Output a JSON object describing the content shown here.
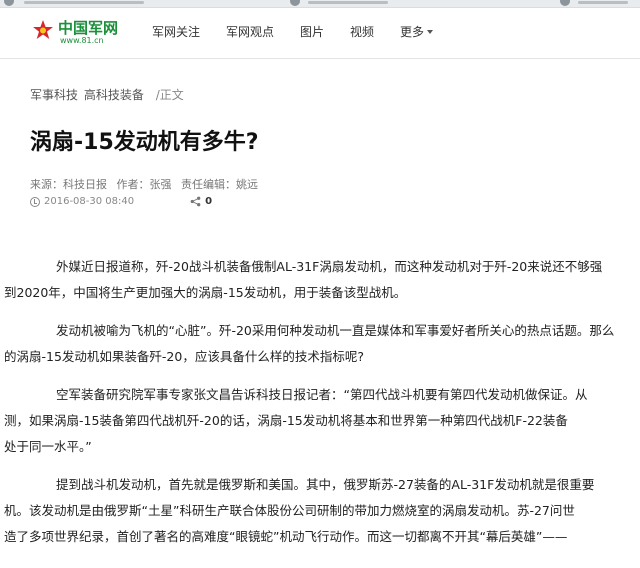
{
  "header": {
    "logo_text": "中国军网",
    "logo_sub": "www.81.cn",
    "nav": [
      "军网关注",
      "军网观点",
      "图片",
      "视频",
      "更多"
    ]
  },
  "breadcrumb": {
    "items": [
      "军事科技",
      "高科技装备"
    ],
    "current": "/正文"
  },
  "article": {
    "title": "涡扇-15发动机有多牛?",
    "source": "来源：科技日报",
    "author": "作者：张强",
    "editor": "责任编辑：姚远",
    "date": "2016-08-30 08:40",
    "share_count": "0",
    "paragraphs": [
      [
        "外媒近日报道称，歼-20战斗机装备俄制AL-31F涡扇发动机，而这种发动机对于歼-20来说还不够强",
        "到2020年，中国将生产更加强大的涡扇-15发动机，用于装备该型战机。"
      ],
      [
        "发动机被喻为飞机的“心脏”。歼-20采用何种发动机一直是媒体和军事爱好者所关心的热点话题。那么",
        "的涡扇-15发动机如果装备歼-20，应该具备什么样的技术指标呢?"
      ],
      [
        "空军装备研究院军事专家张文昌告诉科技日报记者：“第四代战斗机要有第四代发动机做保证。从",
        "测，如果涡扇-15装备第四代战机歼-20的话，涡扇-15发动机将基本和世界第一种第四代战机F-22装备",
        "处于同一水平。”"
      ],
      [
        "提到战斗机发动机，首先就是俄罗斯和美国。其中，俄罗斯苏-27装备的AL-31F发动机就是很重要",
        "机。该发动机是由俄罗斯“土星”科研生产联合体股份公司研制的带加力燃烧室的涡扇发动机。苏-27问世",
        "造了多项世界纪录，首创了著名的高难度“眼镜蛇”机动飞行动作。而这一切都离不开其“幕后英雄”——"
      ]
    ]
  },
  "colors": {
    "brand_green": "#1b8f3a",
    "logo_star_red": "#d8262c"
  }
}
